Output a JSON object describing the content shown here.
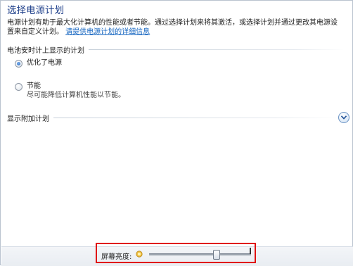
{
  "page": {
    "title": "选择电源计划",
    "description_line1": "电源计划有助于最大化计算机的性能或者节能。通过选择计划来将其激活，或选择计划并通过更改其电源设",
    "description_line2": "置来自定义计划。",
    "description_link": "请提供电源计划的详细信息"
  },
  "plans_group": {
    "header": "电池安时计上显示的计划",
    "plans": [
      {
        "name": "优化了电源",
        "description": "",
        "selected": true
      },
      {
        "name": "节能",
        "description": "尽可能降低计算机性能以节能。",
        "selected": false
      }
    ]
  },
  "more_plans": {
    "header": "显示附加计划",
    "expand_icon": "chevron-down-icon"
  },
  "brightness": {
    "label": "屏幕亮度:",
    "icon": "sun-icon",
    "level": 0.66,
    "highlight_color": "#e01010"
  }
}
